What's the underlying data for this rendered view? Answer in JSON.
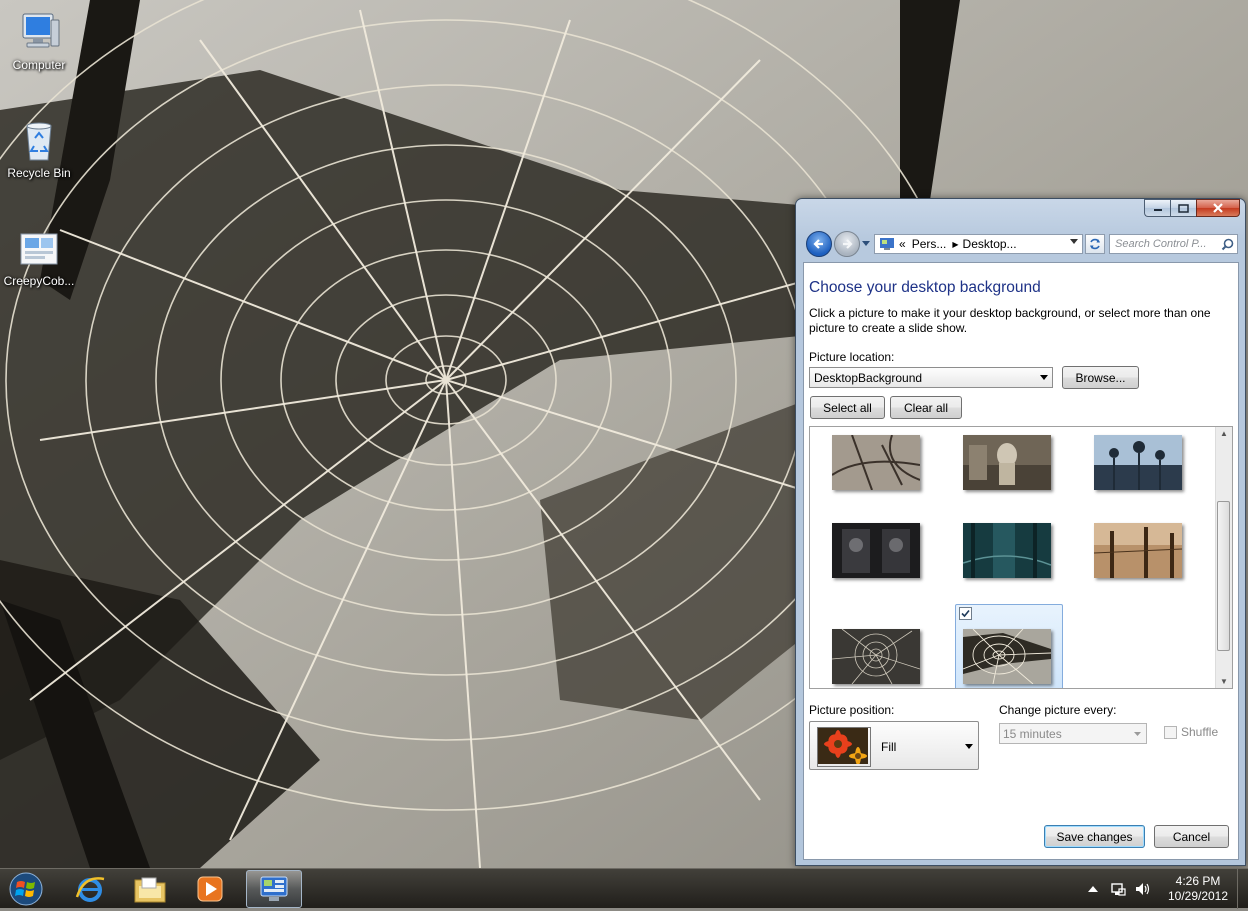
{
  "desktop": {
    "icons": [
      {
        "label": "Computer",
        "icon": "computer-icon"
      },
      {
        "label": "Recycle Bin",
        "icon": "recycle-bin-icon"
      },
      {
        "label": "CreepyCob...",
        "icon": "theme-file-icon"
      }
    ]
  },
  "window": {
    "nav": {
      "crumb_overflow": "«",
      "crumb_1": "Pers...",
      "crumb_2": "Desktop...",
      "search_placeholder": "Search Control P..."
    },
    "title": "Choose your desktop background",
    "description": "Click a picture to make it your desktop background, or select more than one picture to create a slide show.",
    "picture_location_label": "Picture location:",
    "picture_location_value": "DesktopBackground",
    "browse_label": "Browse...",
    "select_all_label": "Select all",
    "clear_all_label": "Clear all",
    "thumbnails": [
      {
        "name": "branches",
        "selected": false
      },
      {
        "name": "statue",
        "selected": false
      },
      {
        "name": "thistles",
        "selected": false
      },
      {
        "name": "carved-door",
        "selected": false
      },
      {
        "name": "teal-forest",
        "selected": false
      },
      {
        "name": "sepia-fence",
        "selected": false
      },
      {
        "name": "dark-web",
        "selected": false
      },
      {
        "name": "spider-web",
        "selected": true
      }
    ],
    "picture_position_label": "Picture position:",
    "picture_position_value": "Fill",
    "change_every_label": "Change picture every:",
    "change_every_value": "15 minutes",
    "shuffle_label": "Shuffle",
    "save_label": "Save changes",
    "cancel_label": "Cancel"
  },
  "taskbar": {
    "pinned": [
      "internet-explorer-icon",
      "windows-explorer-icon",
      "media-player-icon",
      "control-panel-icon"
    ],
    "time": "4:26 PM",
    "date": "10/29/2012"
  },
  "colors": {
    "title_blue": "#1e3287",
    "selection_fill": "#cfe5fb"
  }
}
